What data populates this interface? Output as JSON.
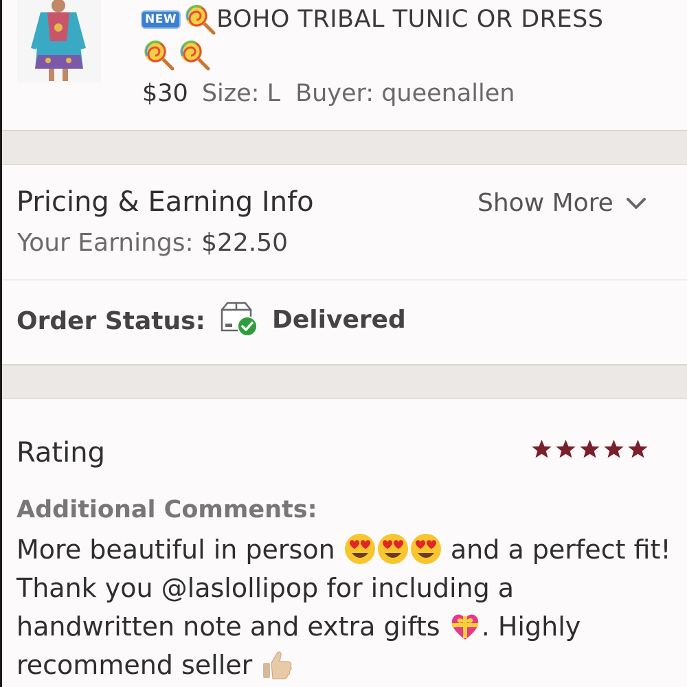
{
  "listing": {
    "badge": "NEW",
    "title": "BOHO TRIBAL TUNIC OR DRESS",
    "price": "$30",
    "size": "Size: L",
    "buyer": "Buyer: queenallen",
    "icons": [
      "new-badge",
      "lollipop-icon",
      "lollipop-icon",
      "lollipop-icon"
    ]
  },
  "pricing": {
    "title": "Pricing & Earning Info",
    "show_more": "Show More",
    "earnings_label": "Your Earnings:",
    "earnings_value": "$22.50"
  },
  "order_status": {
    "label": "Order Status:",
    "value": "Delivered",
    "icon": "delivered-box-icon"
  },
  "rating": {
    "title": "Rating",
    "stars": 5,
    "star_color": "#7a1f2b",
    "comments_label": "Additional Comments:",
    "comment_part1": "More beautiful in person",
    "comment_part2": "and a perfect fit! Thank you @laslollipop for including a handwritten note and extra gifts",
    "comment_part3": ". Highly recommend seller",
    "emojis": [
      "heart-eyes-emoji",
      "heart-eyes-emoji",
      "heart-eyes-emoji",
      "gift-heart-emoji",
      "thumbs-up-emoji"
    ]
  },
  "colors": {
    "background": "#fcfafa",
    "band": "#ebe8e5",
    "text": "#333333",
    "star": "#7a1f2b",
    "check": "#2e9e3c"
  }
}
